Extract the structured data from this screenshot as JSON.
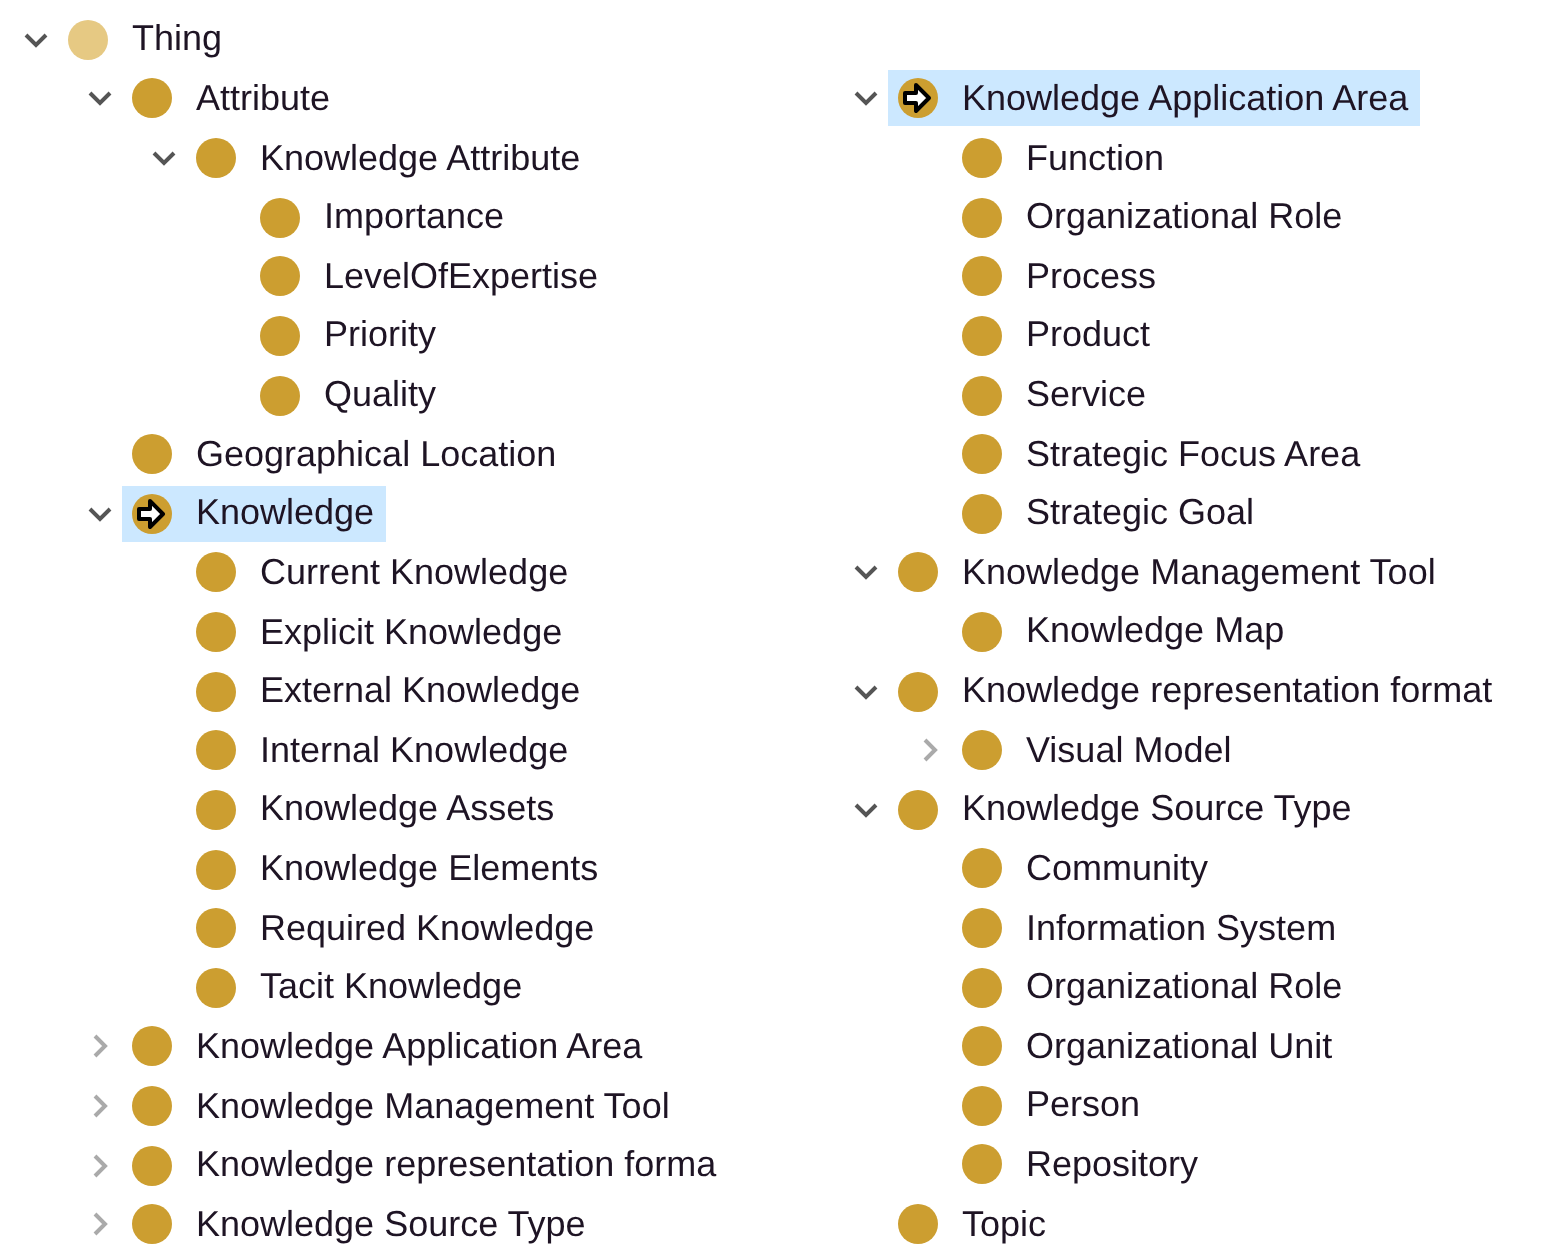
{
  "left_tree": [
    {
      "label": "Thing",
      "kind": "root",
      "expanded": true,
      "selected": false,
      "children": [
        {
          "label": "Attribute",
          "kind": "class",
          "expanded": true,
          "selected": false,
          "children": [
            {
              "label": "Knowledge Attribute",
              "kind": "class",
              "expanded": true,
              "selected": false,
              "children": [
                {
                  "label": "Importance",
                  "kind": "class",
                  "selected": false
                },
                {
                  "label": "LevelOfExpertise",
                  "kind": "class",
                  "selected": false
                },
                {
                  "label": "Priority",
                  "kind": "class",
                  "selected": false
                },
                {
                  "label": "Quality",
                  "kind": "class",
                  "selected": false
                }
              ]
            }
          ]
        },
        {
          "label": "Geographical Location",
          "kind": "class",
          "selected": false
        },
        {
          "label": "Knowledge",
          "kind": "class",
          "expanded": true,
          "selected": true,
          "children": [
            {
              "label": "Current Knowledge",
              "kind": "class",
              "selected": false
            },
            {
              "label": "Explicit Knowledge",
              "kind": "class",
              "selected": false
            },
            {
              "label": "External Knowledge",
              "kind": "class",
              "selected": false
            },
            {
              "label": "Internal Knowledge",
              "kind": "class",
              "selected": false
            },
            {
              "label": "Knowledge Assets",
              "kind": "class",
              "selected": false
            },
            {
              "label": "Knowledge Elements",
              "kind": "class",
              "selected": false
            },
            {
              "label": "Required Knowledge",
              "kind": "class",
              "selected": false
            },
            {
              "label": "Tacit Knowledge",
              "kind": "class",
              "selected": false
            }
          ]
        },
        {
          "label": "Knowledge Application Area",
          "kind": "class",
          "expanded": false,
          "selected": false
        },
        {
          "label": "Knowledge Management Tool",
          "kind": "class",
          "expanded": false,
          "selected": false
        },
        {
          "label": "Knowledge representation forma",
          "kind": "class",
          "expanded": false,
          "selected": false
        },
        {
          "label": "Knowledge Source Type",
          "kind": "class",
          "expanded": false,
          "selected": false
        }
      ]
    }
  ],
  "right_tree": [
    {
      "label": "Knowledge Application Area",
      "kind": "class",
      "expanded": true,
      "selected": true,
      "children": [
        {
          "label": "Function",
          "kind": "class",
          "selected": false
        },
        {
          "label": "Organizational Role",
          "kind": "class",
          "selected": false
        },
        {
          "label": "Process",
          "kind": "class",
          "selected": false
        },
        {
          "label": "Product",
          "kind": "class",
          "selected": false
        },
        {
          "label": "Service",
          "kind": "class",
          "selected": false
        },
        {
          "label": "Strategic Focus Area",
          "kind": "class",
          "selected": false
        },
        {
          "label": "Strategic Goal",
          "kind": "class",
          "selected": false
        }
      ]
    },
    {
      "label": "Knowledge Management Tool",
      "kind": "class",
      "expanded": true,
      "selected": false,
      "children": [
        {
          "label": "Knowledge Map",
          "kind": "class",
          "selected": false
        }
      ]
    },
    {
      "label": "Knowledge representation format",
      "kind": "class",
      "expanded": true,
      "selected": false,
      "children": [
        {
          "label": "Visual Model",
          "kind": "class",
          "expanded": false,
          "selected": false
        }
      ]
    },
    {
      "label": "Knowledge Source Type",
      "kind": "class",
      "expanded": true,
      "selected": false,
      "children": [
        {
          "label": "Community",
          "kind": "class",
          "selected": false
        },
        {
          "label": "Information System",
          "kind": "class",
          "selected": false
        },
        {
          "label": "Organizational Role",
          "kind": "class",
          "selected": false
        },
        {
          "label": "Organizational Unit",
          "kind": "class",
          "selected": false
        },
        {
          "label": "Person",
          "kind": "class",
          "selected": false
        },
        {
          "label": "Repository",
          "kind": "class",
          "selected": false
        }
      ]
    },
    {
      "label": "Topic",
      "kind": "class",
      "selected": false
    }
  ]
}
